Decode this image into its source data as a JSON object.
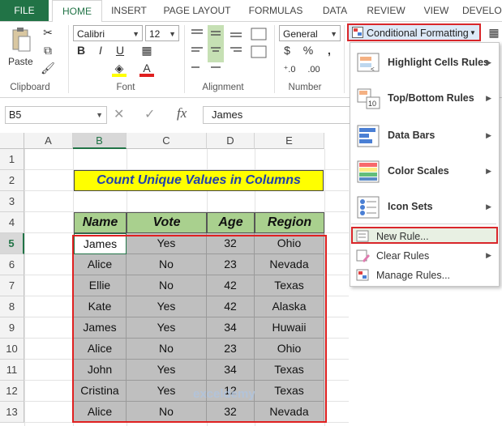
{
  "tabs": [
    "FILE",
    "HOME",
    "INSERT",
    "PAGE LAYOUT",
    "FORMULAS",
    "DATA",
    "REVIEW",
    "VIEW",
    "DEVELO"
  ],
  "ribbon": {
    "clipboard": {
      "paste": "Paste",
      "label": "Clipboard"
    },
    "font": {
      "name": "Calibri",
      "size": "12",
      "label": "Font",
      "bold": "B",
      "italic": "I",
      "underline": "U"
    },
    "alignment": {
      "label": "Alignment"
    },
    "number": {
      "format": "General",
      "label": "Number",
      "currency": "$",
      "percent": "%",
      "comma": ","
    },
    "conditional_formatting": "Conditional Formatting"
  },
  "formula_bar": {
    "name_box": "B5",
    "cancel": "✕",
    "enter": "✓",
    "fx": "fx",
    "value": "James"
  },
  "columns": [
    "A",
    "B",
    "C",
    "D",
    "E"
  ],
  "rows": [
    "1",
    "2",
    "3",
    "4",
    "5",
    "6",
    "7",
    "8",
    "9",
    "10",
    "11",
    "12",
    "13"
  ],
  "title": "Count Unique Values in Columns",
  "table": {
    "headers": [
      "Name",
      "Vote",
      "Age",
      "Region"
    ],
    "rows": [
      [
        "James",
        "Yes",
        "32",
        "Ohio"
      ],
      [
        "Alice",
        "No",
        "23",
        "Nevada"
      ],
      [
        "Ellie",
        "No",
        "42",
        "Texas"
      ],
      [
        "Kate",
        "Yes",
        "42",
        "Alaska"
      ],
      [
        "James",
        "Yes",
        "34",
        "Huwaii"
      ],
      [
        "Alice",
        "No",
        "23",
        "Ohio"
      ],
      [
        "John",
        "Yes",
        "34",
        "Texas"
      ],
      [
        "Cristina",
        "Yes",
        "12",
        "Texas"
      ],
      [
        "Alice",
        "No",
        "32",
        "Nevada"
      ]
    ]
  },
  "menu": {
    "items": [
      {
        "label": "Highlight Cells Rules",
        "icon": "highlight-cells-icon"
      },
      {
        "label": "Top/Bottom Rules",
        "icon": "top-bottom-icon"
      },
      {
        "label": "Data Bars",
        "icon": "data-bars-icon"
      },
      {
        "label": "Color Scales",
        "icon": "color-scales-icon"
      },
      {
        "label": "Icon Sets",
        "icon": "icon-sets-icon"
      }
    ],
    "small_items": [
      {
        "label": "New Rule...",
        "icon": "new-rule-icon"
      },
      {
        "label": "Clear Rules",
        "icon": "clear-rules-icon"
      },
      {
        "label": "Manage Rules...",
        "icon": "manage-rules-icon"
      }
    ]
  },
  "watermark": "exceldemy",
  "colors": {
    "accent": "#217346",
    "highlight_red": "#d9262a",
    "header_green": "#a9d08e",
    "title_yellow": "#ffff00",
    "title_text": "#1f3fae"
  }
}
